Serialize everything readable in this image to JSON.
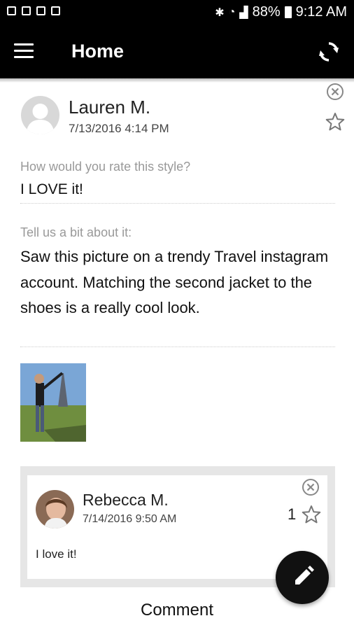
{
  "status_bar": {
    "icons_left": [
      "gallery-notification-icon",
      "flipboard-notification-icon",
      "sim-notification-icon",
      "screenshot-notification-icon"
    ],
    "battery": "88%",
    "time": "9:12 AM"
  },
  "app_bar": {
    "title": "Home"
  },
  "post": {
    "author": "Lauren M.",
    "date": "7/13/2016 4:14 PM",
    "question_1": "How would you rate this style?",
    "answer_1": "I LOVE it!",
    "question_2": "Tell us a bit about it:",
    "answer_2": "Saw this picture on a trendy Travel instagram account. Matching the second jacket to the shoes is a really cool look."
  },
  "comment": {
    "author": "Rebecca M.",
    "date": "7/14/2016 9:50 AM",
    "text": "I love it!",
    "likes": "1"
  },
  "comment_button": "Comment",
  "colors": {
    "bar": "#000000",
    "muted": "#999999",
    "comment_bg": "#e6e6e6"
  }
}
